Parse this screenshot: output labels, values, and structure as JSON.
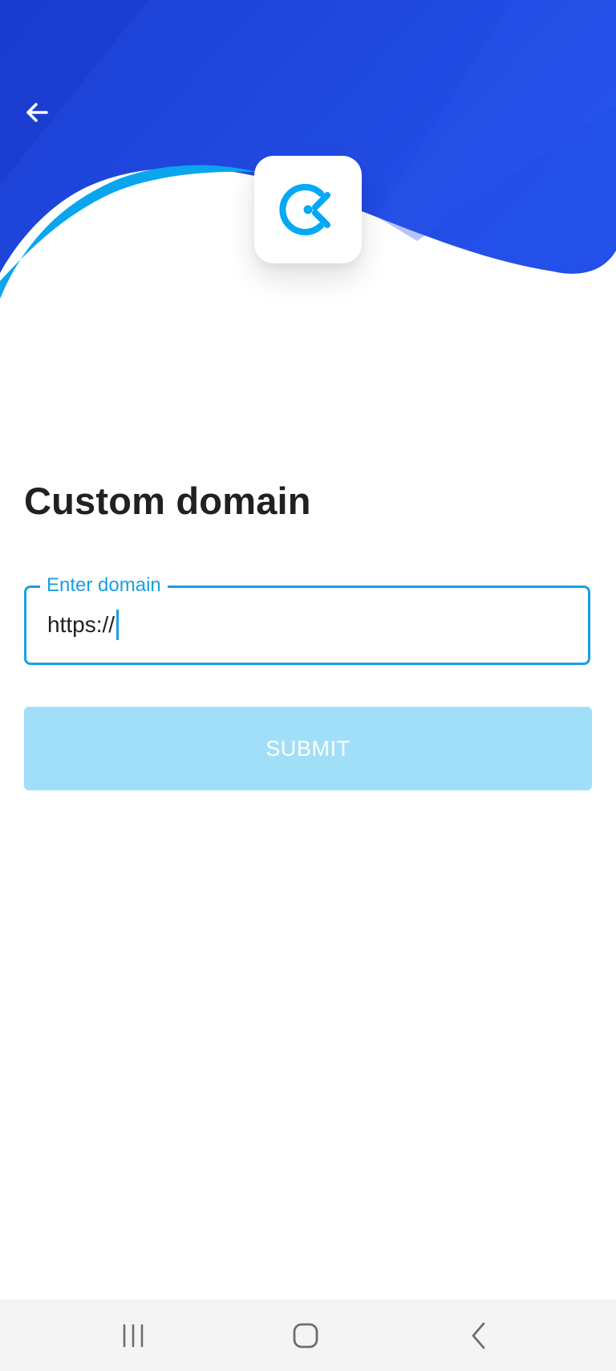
{
  "colors": {
    "hero_blue": "#2350e6",
    "hero_light_blue": "#0aa5ee",
    "accent": "#1a9fe0",
    "submit_disabled": "#a1dff8",
    "nav_bg": "#f4f4f4"
  },
  "header": {
    "back_icon": "arrow-left-icon",
    "logo_icon": "clockify-logo-icon"
  },
  "main": {
    "title": "Custom domain",
    "domain_field": {
      "label": "Enter domain",
      "value": "https://"
    },
    "submit_label": "SUBMIT"
  },
  "system_nav": {
    "recents_icon": "recent-apps-icon",
    "home_icon": "home-icon",
    "back_icon": "back-chevron-icon"
  }
}
